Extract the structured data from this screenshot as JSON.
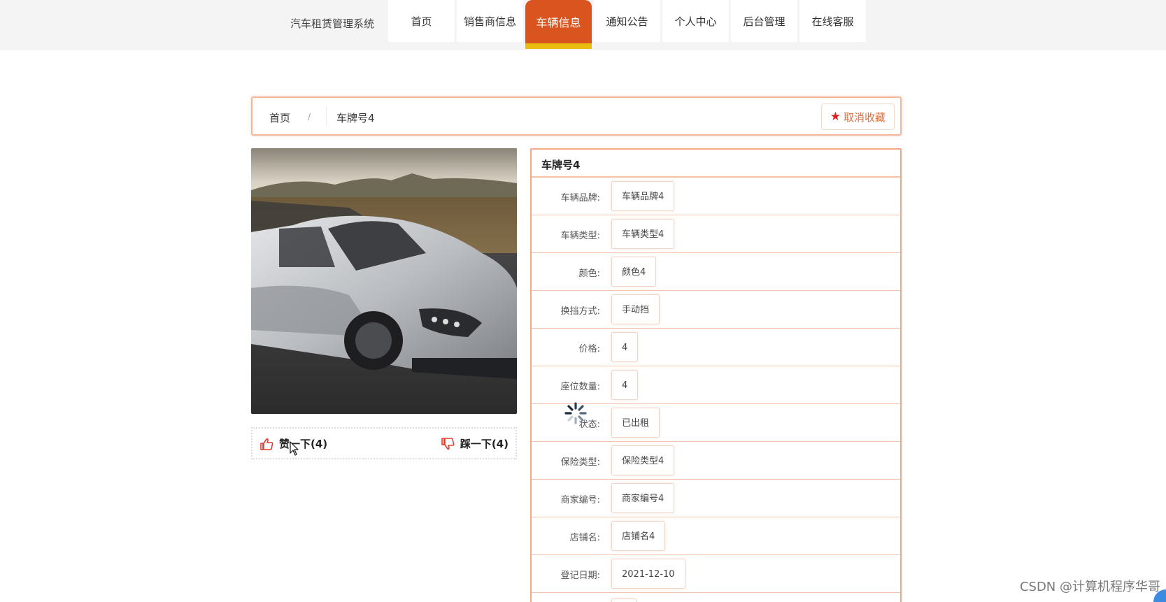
{
  "header": {
    "site_title": "汽车租赁管理系统",
    "nav": [
      {
        "label": "首页"
      },
      {
        "label": "销售商信息"
      },
      {
        "label": "车辆信息",
        "active": true
      },
      {
        "label": "通知公告"
      },
      {
        "label": "个人中心"
      },
      {
        "label": "后台管理"
      },
      {
        "label": "在线客服"
      }
    ]
  },
  "breadcrumb": {
    "home": "首页",
    "separator": "/",
    "current": "车牌号4",
    "favorite_label": "取消收藏",
    "favorite_icon": "star-icon"
  },
  "vote": {
    "like_label": "赞一下(4)",
    "dislike_label": "踩一下(4)"
  },
  "detail": {
    "title": "车牌号4",
    "rows": [
      {
        "label": "车辆品牌:",
        "value": "车辆品牌4"
      },
      {
        "label": "车辆类型:",
        "value": "车辆类型4"
      },
      {
        "label": "颜色:",
        "value": "颜色4"
      },
      {
        "label": "换挡方式:",
        "value": "手动挡"
      },
      {
        "label": "价格:",
        "value": "4"
      },
      {
        "label": "座位数量:",
        "value": "4"
      },
      {
        "label": "状态:",
        "value": "已出租"
      },
      {
        "label": "保险类型:",
        "value": "保险类型4"
      },
      {
        "label": "商家编号:",
        "value": "商家编号4"
      },
      {
        "label": "店铺名:",
        "value": "店铺名4"
      },
      {
        "label": "登记日期:",
        "value": "2021-12-10"
      }
    ]
  },
  "watermark": "CSDN @计算机程序华哥",
  "colors": {
    "accent": "#d9541f",
    "accent_underline": "#e8bd0f",
    "border": "#f4a784"
  }
}
